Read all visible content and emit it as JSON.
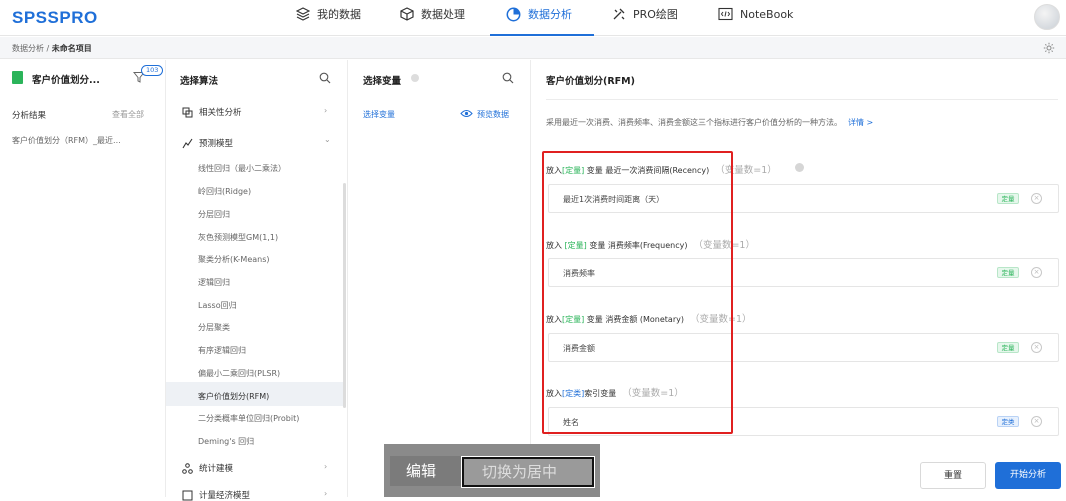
{
  "app": {
    "logo": "SPSSPRO"
  },
  "nav": {
    "items": [
      {
        "label": "我的数据",
        "icon": "layers-icon"
      },
      {
        "label": "数据处理",
        "icon": "cube-icon"
      },
      {
        "label": "数据分析",
        "icon": "pie-chart-icon",
        "active": true
      },
      {
        "label": "PRO绘图",
        "icon": "brush-icon"
      },
      {
        "label": "NoteBook",
        "icon": "code-icon"
      }
    ],
    "accent": "#1f6fd8"
  },
  "breadcrumb": {
    "parent": "数据分析",
    "separator": " / ",
    "current": "未命名项目"
  },
  "left_panel": {
    "title": "客户价值划分...",
    "badge": "103",
    "results_label": "分析结果",
    "view_all": "查看全部",
    "result_item": "客户价值划分（RFM）_最近..."
  },
  "algo_panel": {
    "title": "选择算法",
    "groups": [
      {
        "label": "相关性分析",
        "caret": "›"
      },
      {
        "label": "预测模型",
        "caret": "⌄"
      },
      {
        "label": "统计建模",
        "caret": "›"
      },
      {
        "label": "计量经济模型",
        "caret": "›"
      }
    ],
    "items": [
      "线性回归（最小二乘法）",
      "岭回归(Ridge)",
      "分层回归",
      "灰色预测模型GM(1,1)",
      "聚类分析(K-Means)",
      "逻辑回归",
      "Lasso回归",
      "分层聚类",
      "有序逻辑回归",
      "偏最小二乘回归(PLSR)",
      "客户价值划分(RFM)",
      "二分类概率单位回归(Probit)",
      "Deming's 回归"
    ],
    "selected_item": "客户价值划分(RFM)"
  },
  "var_panel": {
    "title": "选择变量",
    "select_label": "选择变量",
    "preview_label": "预览数据"
  },
  "main": {
    "title": "客户价值划分(RFM)",
    "description": "采用最近一次消费、消费频率、消费金额这三个指标进行客户价值分析的一种方法。",
    "detail_link": "详情 >",
    "slots": [
      {
        "prefix": "放入",
        "type": "[定量]",
        "label": "变量 最近一次消费间隔(Recency)",
        "count": "（变量数=1）",
        "variable": "最近1次消费时间距离（天）",
        "tag": "定量",
        "tag_color": "green"
      },
      {
        "prefix": "放入",
        "type": "[定量]",
        "label": "变量 消费频率(Frequency)",
        "count": "（变量数=1）",
        "variable": "消费频率",
        "tag": "定量",
        "tag_color": "green"
      },
      {
        "prefix": "放入",
        "type": "[定量]",
        "label": "变量 消费金额 (Monetary)",
        "count": "（变量数=1）",
        "variable": "消费金额",
        "tag": "定量",
        "tag_color": "green"
      },
      {
        "prefix": "放入",
        "type": "[定类]",
        "label": "索引变量",
        "count": "（变量数=1）",
        "variable": "姓名",
        "tag": "定类",
        "tag_color": "blue"
      }
    ],
    "reset_label": "重置",
    "start_label": "开始分析"
  },
  "overlay": {
    "left_label": "编辑",
    "right_label": "切换为居中"
  }
}
